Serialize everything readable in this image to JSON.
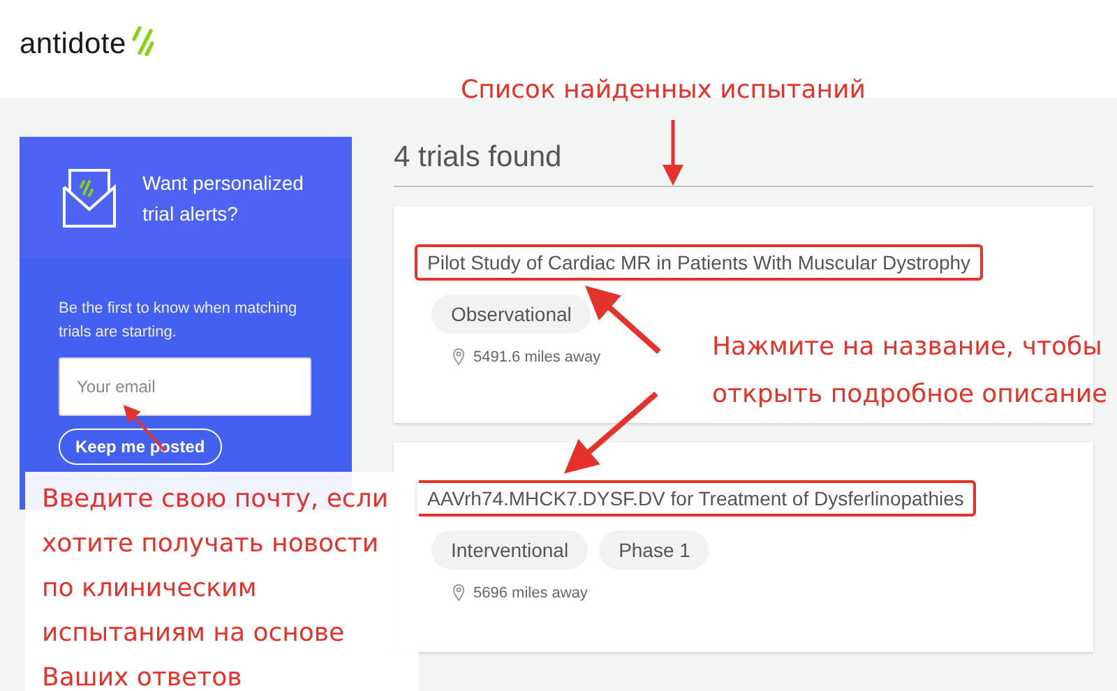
{
  "header": {
    "logo": "antidote"
  },
  "alerts": {
    "title": "Want personalized trial alerts?",
    "text": "Be the first to know when matching trials are starting.",
    "email": {
      "placeholder": "Your email"
    },
    "button": "Keep me posted"
  },
  "results": {
    "heading": "4 trials found",
    "trials": [
      {
        "title": "Pilot Study of Cardiac MR in Patients With Muscular Dystrophy",
        "highlighted": true,
        "tags": [
          "Observational"
        ],
        "distance": "5491.6 miles away"
      },
      {
        "title": "AAVrh74.MHCK7.DYSF.DV for Treatment of Dysferlinopathies",
        "highlighted": true,
        "tags": [
          "Interventional",
          "Phase 1"
        ],
        "distance": "5696 miles away"
      }
    ]
  },
  "annotations": [
    {
      "kind": "top",
      "text": "Список найденных испытаний"
    },
    {
      "kind": "right",
      "text": "Нажмите на название, чтобы открыть подробное описание"
    },
    {
      "kind": "left",
      "text": "Введите свою почту, если хотите получать новости по клиническим испытаниям на основе Ваших ответов"
    }
  ]
}
